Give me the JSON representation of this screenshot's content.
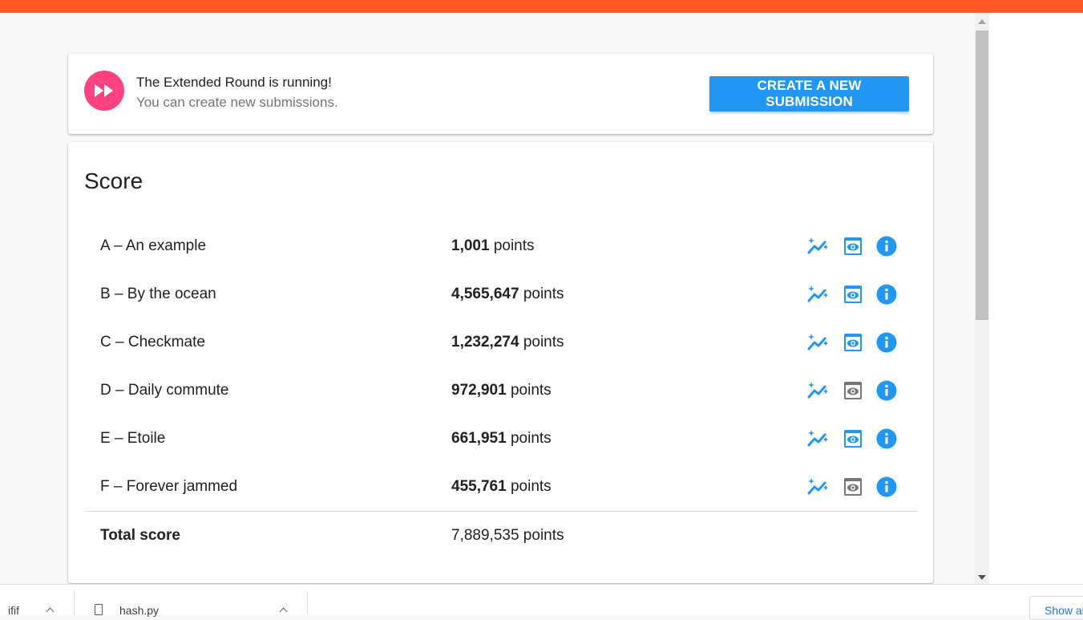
{
  "banner": {
    "title": "The Extended Round is running!",
    "subtitle": "You can create new submissions.",
    "icon": "fast-forward-icon",
    "button_label": "CREATE A NEW SUBMISSION"
  },
  "score": {
    "title": "Score",
    "unit": "points",
    "rows": [
      {
        "name": "A – An example",
        "points": "1,001",
        "icons": [
          "chart-sparkle-icon",
          "eye-icon",
          "info-icon"
        ],
        "eye_active": true
      },
      {
        "name": "B – By the ocean",
        "points": "4,565,647",
        "icons": [
          "chart-sparkle-icon",
          "eye-icon",
          "info-icon"
        ],
        "eye_active": true
      },
      {
        "name": "C – Checkmate",
        "points": "1,232,274",
        "icons": [
          "chart-sparkle-icon",
          "eye-icon",
          "info-icon"
        ],
        "eye_active": true
      },
      {
        "name": "D – Daily commute",
        "points": "972,901",
        "icons": [
          "chart-sparkle-icon",
          "eye-icon",
          "info-icon"
        ],
        "eye_active": false
      },
      {
        "name": "E – Etoile",
        "points": "661,951",
        "icons": [
          "chart-sparkle-icon",
          "eye-icon",
          "info-icon"
        ],
        "eye_active": true
      },
      {
        "name": "F – Forever jammed",
        "points": "455,761",
        "icons": [
          "chart-sparkle-icon",
          "eye-icon",
          "info-icon"
        ],
        "eye_active": false
      }
    ],
    "total": {
      "label": "Total score",
      "points": "7,889,535 points"
    }
  },
  "downloads": {
    "items": [
      {
        "name": "ifif"
      },
      {
        "name": "hash.py"
      }
    ],
    "show_all": "Show all"
  },
  "colors": {
    "topbar": "#ff5722",
    "accent": "#2196f3",
    "banner_icon": "#ff4081",
    "eye_inactive": "#757575"
  }
}
